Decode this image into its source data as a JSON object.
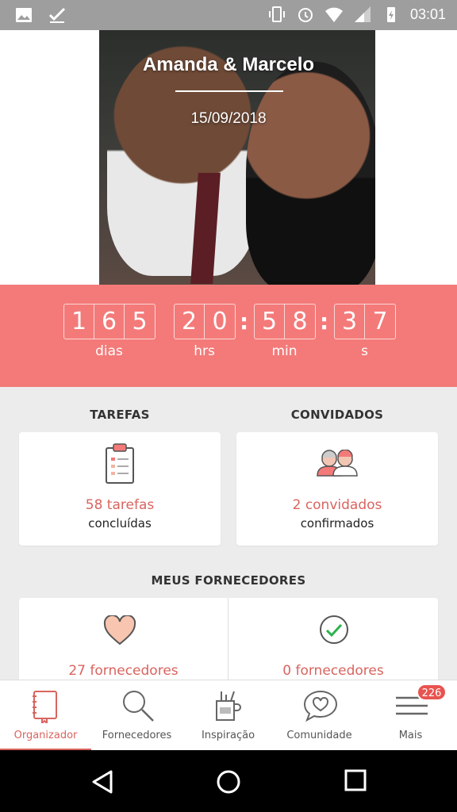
{
  "status_bar": {
    "time": "03:01",
    "left_icons": [
      "image-icon",
      "check-icon"
    ],
    "right_icons": [
      "vibrate-icon",
      "alarm-icon",
      "wifi-icon",
      "signal-icon",
      "battery-charging-icon"
    ]
  },
  "hero": {
    "couple_names": "Amanda & Marcelo",
    "wedding_date": "15/09/2018"
  },
  "countdown": {
    "days": [
      "1",
      "6",
      "5"
    ],
    "hours": [
      "2",
      "0"
    ],
    "minutes": [
      "5",
      "8"
    ],
    "seconds": [
      "3",
      "7"
    ],
    "labels": {
      "days": "dias",
      "hours": "hrs",
      "minutes": "min",
      "seconds": "s"
    }
  },
  "tasks": {
    "title": "TAREFAS",
    "value": "58 tarefas",
    "sub": "concluídas"
  },
  "guests": {
    "title": "CONVIDADOS",
    "value": "2 convidados",
    "sub": "confirmados"
  },
  "vendors": {
    "title": "MEUS FORNECEDORES",
    "favorites_value": "27 fornecedores",
    "hired_value": "0 fornecedores"
  },
  "bottom_nav": {
    "items": [
      {
        "label": "Organizador",
        "icon": "notebook-icon",
        "active": true
      },
      {
        "label": "Fornecedores",
        "icon": "search-icon",
        "active": false
      },
      {
        "label": "Inspiração",
        "icon": "brush-cup-icon",
        "active": false
      },
      {
        "label": "Comunidade",
        "icon": "heart-chat-icon",
        "active": false
      },
      {
        "label": "Mais",
        "icon": "menu-icon",
        "active": false
      }
    ],
    "badge": "226"
  },
  "colors": {
    "accent": "#f37a79",
    "accent_text": "#d9645f",
    "badge": "#e8544f"
  }
}
